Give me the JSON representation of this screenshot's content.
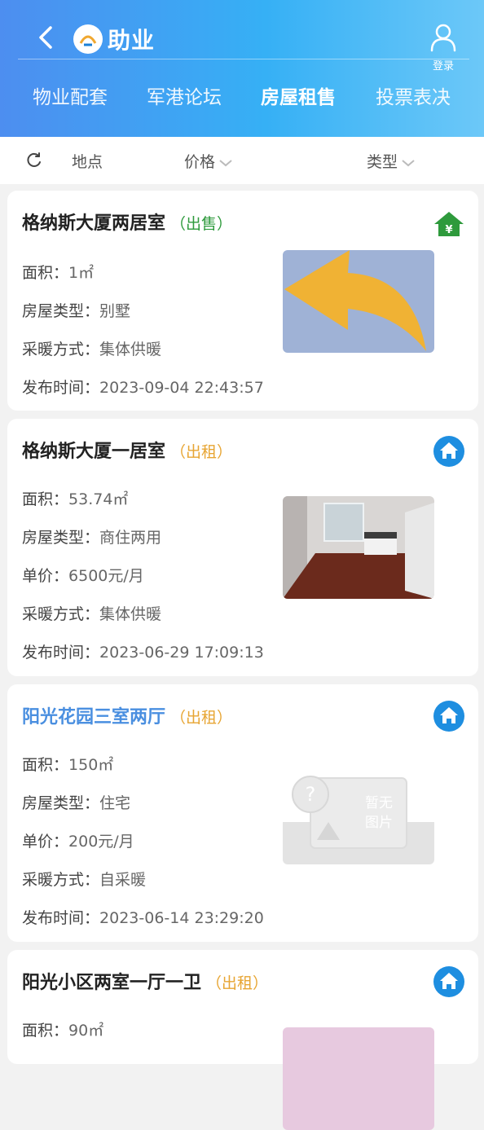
{
  "header": {
    "logo_text": "助业",
    "login_label": "登录",
    "tabs": [
      {
        "label": "物业配套",
        "active": false
      },
      {
        "label": "军港论坛",
        "active": false
      },
      {
        "label": "房屋租售",
        "active": true
      },
      {
        "label": "投票表决",
        "active": false
      }
    ]
  },
  "filters": {
    "location": "地点",
    "price": "价格",
    "type": "类型"
  },
  "listings": [
    {
      "title": "格纳斯大厦两居室",
      "tag": "（出售）",
      "badge_icon": "house-yuan-icon",
      "image": "arrow-placeholder-image",
      "rows": [
        {
          "label": "面积：",
          "value": "1㎡"
        },
        {
          "label": "房屋类型：",
          "value": "别墅"
        },
        {
          "label": "采暖方式：",
          "value": "集体供暖"
        },
        {
          "label": "发布时间：",
          "value": "2023-09-04 22:43:57"
        }
      ]
    },
    {
      "title": "格纳斯大厦一居室",
      "tag": "（出租）",
      "badge_icon": "house-icon",
      "image": "apartment-photo",
      "rows": [
        {
          "label": "面积：",
          "value": "53.74㎡"
        },
        {
          "label": "房屋类型：",
          "value": "商住两用"
        },
        {
          "label": "单价：",
          "value": "6500元/月"
        },
        {
          "label": "采暖方式：",
          "value": "集体供暖"
        },
        {
          "label": "发布时间：",
          "value": "2023-06-29 17:09:13"
        }
      ]
    },
    {
      "title": "阳光花园三室两厅",
      "tag": "（出租）",
      "badge_icon": "house-icon",
      "image": "no-image-placeholder",
      "placeholder_text": [
        "暂无",
        "图片"
      ],
      "rows": [
        {
          "label": "面积：",
          "value": "150㎡"
        },
        {
          "label": "房屋类型：",
          "value": "住宅"
        },
        {
          "label": "单价：",
          "value": "200元/月"
        },
        {
          "label": "采暖方式：",
          "value": "自采暖"
        },
        {
          "label": "发布时间：",
          "value": "2023-06-14 23:29:20"
        }
      ]
    },
    {
      "title": "阳光小区两室一厅一卫",
      "tag": "（出租）",
      "badge_icon": "house-icon",
      "image": "pink-photo",
      "rows": [
        {
          "label": "面积：",
          "value": "90㎡"
        }
      ]
    }
  ],
  "colors": {
    "header_start": "#4d8ef0",
    "header_end": "#6cc8f8",
    "sale_green": "#2e9a3c",
    "rent_orange": "#e7a533",
    "badge_blue": "#1e8ee0",
    "title_blue": "#4a8fe0"
  }
}
